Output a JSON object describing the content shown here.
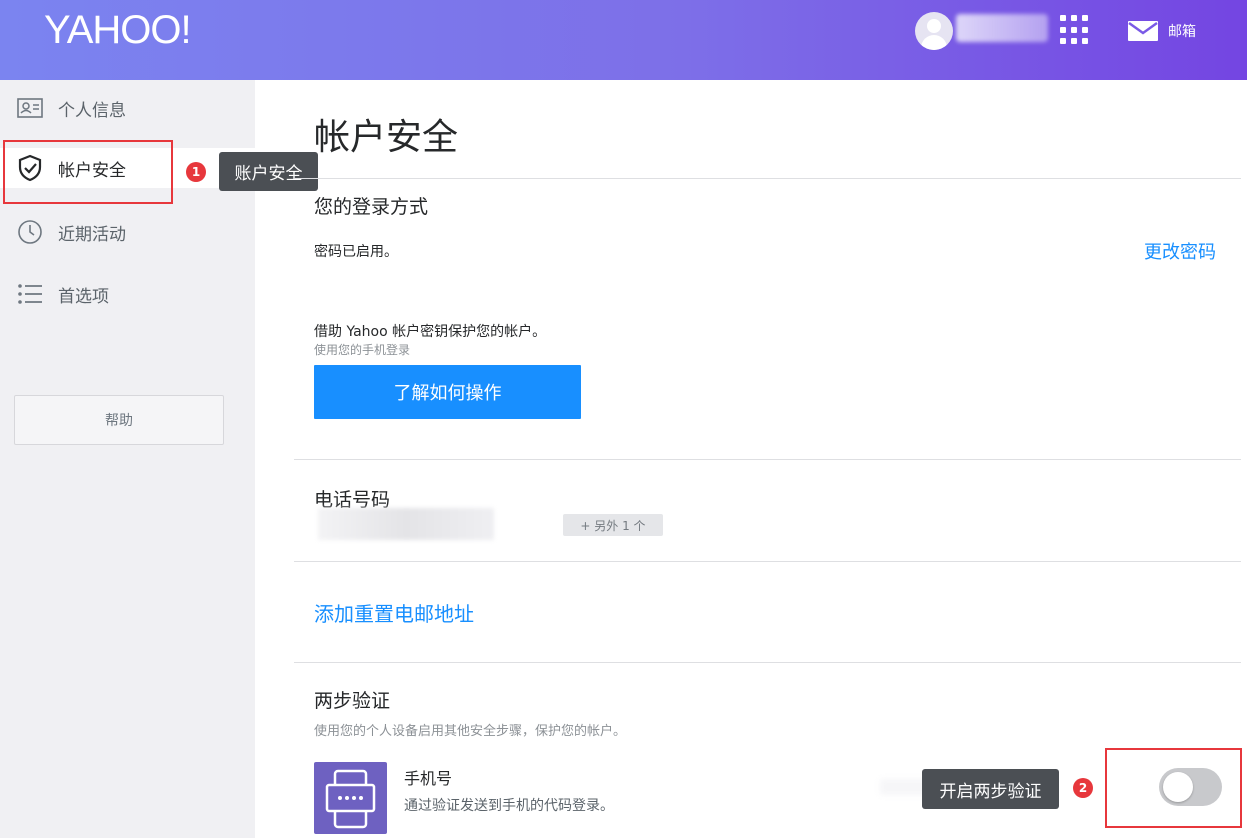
{
  "header": {
    "logo": "YAHOO!",
    "mail_label": "邮箱"
  },
  "sidebar": {
    "items": [
      {
        "label": "个人信息",
        "icon": "id-card-icon"
      },
      {
        "label": "帐户安全",
        "icon": "shield-check-icon",
        "active": true
      },
      {
        "label": "近期活动",
        "icon": "clock-icon"
      },
      {
        "label": "首选项",
        "icon": "list-icon"
      }
    ],
    "help_label": "帮助",
    "annotation": {
      "badge": "1",
      "tooltip": "账户安全"
    }
  },
  "main": {
    "title": "帐户安全",
    "login_section": {
      "title": "您的登录方式",
      "password_status": "密码已启用。",
      "change_password": "更改密码",
      "account_key_text": "借助 Yahoo 帐户密钥保护您的帐户。",
      "account_key_sub": "使用您的手机登录",
      "learn_button": "了解如何操作"
    },
    "phone_section": {
      "title": "电话号码",
      "more_label": "+ 另外 1 个"
    },
    "recovery_email": {
      "link": "添加重置电邮地址"
    },
    "two_step": {
      "title": "两步验证",
      "description": "使用您的个人设备启用其他安全步骤，保护您的帐户。",
      "method_title": "手机号",
      "method_desc": "通过验证发送到手机的代码登录。",
      "annotation": {
        "badge": "2",
        "tooltip": "开启两步验证"
      },
      "enabled": false
    }
  },
  "colors": {
    "accent": "#188fff",
    "highlight": "#e7373c",
    "header_start": "#7b84f0",
    "header_end": "#7445e2",
    "tile": "#6e61c1"
  }
}
